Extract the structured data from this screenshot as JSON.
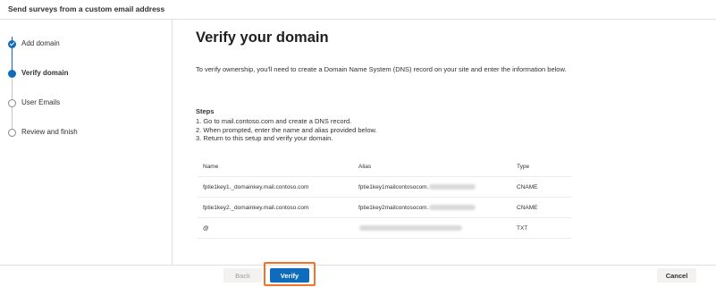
{
  "header": {
    "title": "Send surveys from a custom email address"
  },
  "sidebar": {
    "steps": [
      {
        "label": "Add domain",
        "state": "done"
      },
      {
        "label": "Verify domain",
        "state": "current"
      },
      {
        "label": "User Emails",
        "state": "todo"
      },
      {
        "label": "Review and finish",
        "state": "todo"
      }
    ]
  },
  "main": {
    "title": "Verify your domain",
    "intro": "To verify ownership, you'll need to create a Domain Name System (DNS) record on your site and enter the information below.",
    "steps_heading": "Steps",
    "steps": [
      "1. Go to mail.contoso.com and create a DNS record.",
      "2. When prompted, enter the name and alias provided below.",
      "3. Return to this setup and verify your domain."
    ],
    "table": {
      "headers": {
        "name": "Name",
        "alias": "Alias",
        "type": "Type"
      },
      "rows": [
        {
          "name": "fptie1key1._domainkey.mail.contoso.com",
          "alias": "fptie1key1mailcontosocom.",
          "type": "CNAME"
        },
        {
          "name": "fptie1key2._domainkey.mail.contoso.com",
          "alias": "fptie1key2mailcontosocom.",
          "type": "CNAME"
        },
        {
          "name": "@",
          "alias": "",
          "type": "TXT"
        }
      ]
    }
  },
  "footer": {
    "back_label": "Back",
    "verify_label": "Verify",
    "cancel_label": "Cancel"
  },
  "colors": {
    "accent": "#0f6cbd",
    "highlight": "#f0732a"
  }
}
